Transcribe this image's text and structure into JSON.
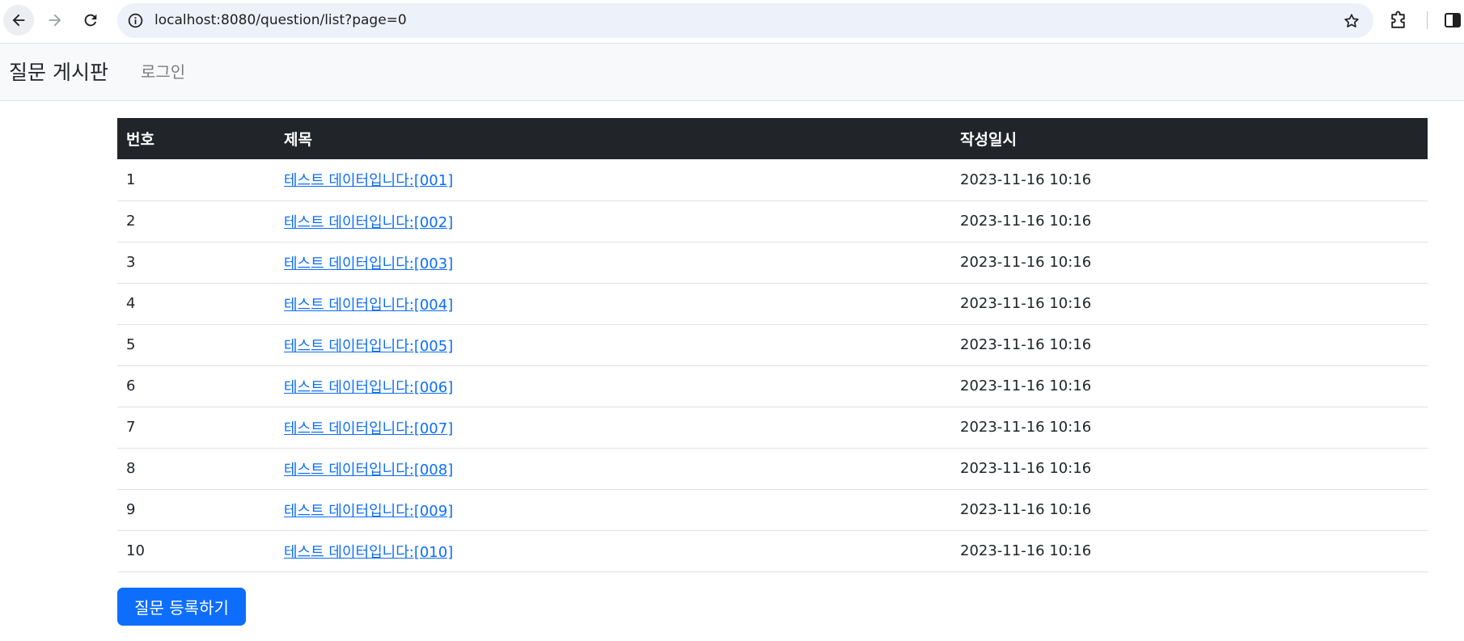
{
  "browser": {
    "url": "localhost:8080/question/list?page=0"
  },
  "navbar": {
    "brand": "질문 게시판",
    "login_label": "로그인"
  },
  "table": {
    "headers": [
      "번호",
      "제목",
      "작성일시"
    ],
    "rows": [
      {
        "num": "1",
        "subject": "테스트 데이터입니다:[001]",
        "date": "2023-11-16 10:16"
      },
      {
        "num": "2",
        "subject": "테스트 데이터입니다:[002]",
        "date": "2023-11-16 10:16"
      },
      {
        "num": "3",
        "subject": "테스트 데이터입니다:[003]",
        "date": "2023-11-16 10:16"
      },
      {
        "num": "4",
        "subject": "테스트 데이터입니다:[004]",
        "date": "2023-11-16 10:16"
      },
      {
        "num": "5",
        "subject": "테스트 데이터입니다:[005]",
        "date": "2023-11-16 10:16"
      },
      {
        "num": "6",
        "subject": "테스트 데이터입니다:[006]",
        "date": "2023-11-16 10:16"
      },
      {
        "num": "7",
        "subject": "테스트 데이터입니다:[007]",
        "date": "2023-11-16 10:16"
      },
      {
        "num": "8",
        "subject": "테스트 데이터입니다:[008]",
        "date": "2023-11-16 10:16"
      },
      {
        "num": "9",
        "subject": "테스트 데이터입니다:[009]",
        "date": "2023-11-16 10:16"
      },
      {
        "num": "10",
        "subject": "테스트 데이터입니다:[010]",
        "date": "2023-11-16 10:16"
      }
    ]
  },
  "actions": {
    "register_label": "질문 등록하기"
  },
  "colors": {
    "link": "#0d6efd",
    "header_bg": "#212529",
    "button_bg": "#0d6efd",
    "navbar_bg": "#f8f9fa"
  },
  "icons": {
    "back": "arrow-left-icon",
    "forward": "arrow-right-icon",
    "reload": "reload-icon",
    "site_info": "info-icon",
    "bookmark": "star-icon",
    "extensions": "puzzle-icon",
    "side_panel": "side-panel-icon"
  }
}
